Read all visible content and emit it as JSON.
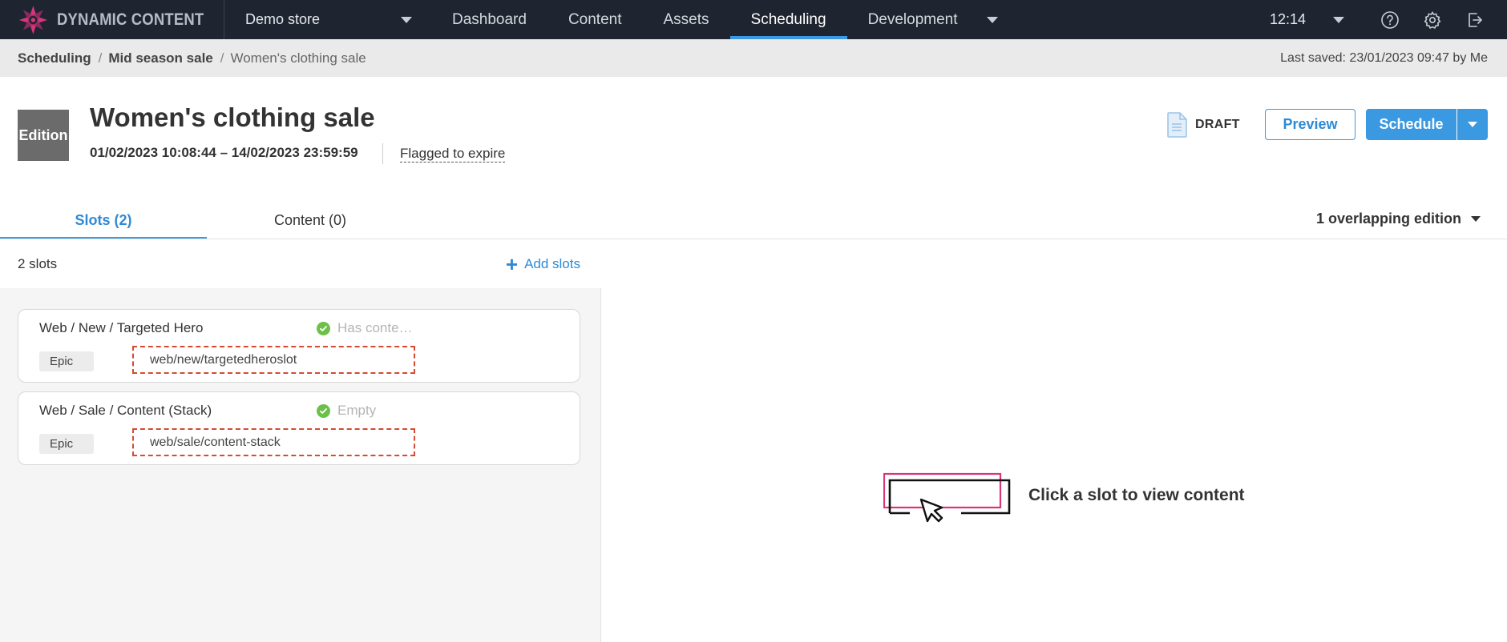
{
  "app": {
    "logo_text": "DYNAMIC CONTENT",
    "store": "Demo store",
    "nav": [
      "Dashboard",
      "Content",
      "Assets",
      "Scheduling",
      "Development"
    ],
    "active_nav": "Scheduling",
    "time": "12:14"
  },
  "breadcrumb": {
    "items": [
      "Scheduling",
      "Mid season sale",
      "Women's clothing sale"
    ],
    "separator": "/",
    "last_saved": "Last saved: 23/01/2023 09:47 by Me"
  },
  "edition": {
    "badge": "Edition",
    "title": "Women's clothing sale",
    "dates": "01/02/2023 10:08:44  –  14/02/2023 23:59:59",
    "flag": "Flagged to expire",
    "status": "DRAFT",
    "preview_label": "Preview",
    "schedule_label": "Schedule"
  },
  "tabs": [
    {
      "label": "Slots (2)",
      "active": true
    },
    {
      "label": "Content (0)",
      "active": false
    }
  ],
  "overlap_label": "1 overlapping edition",
  "slots": {
    "count_label": "2 slots",
    "add_label": "Add slots",
    "items": [
      {
        "name": "Web / New / Targeted Hero",
        "status": "Has conte…",
        "tag": "Epic",
        "path": "web/new/targetedheroslot"
      },
      {
        "name": "Web / Sale / Content (Stack)",
        "status": "Empty",
        "tag": "Epic",
        "path": "web/sale/content-stack"
      }
    ]
  },
  "empty_state": "Click a slot to view content",
  "colors": {
    "topbar": "#1f2530",
    "accent": "#3a99e0",
    "logo_pink": "#d9357a",
    "dashed_red": "#d54a32",
    "check_green": "#6cc04a"
  },
  "icons": [
    "logo-icon",
    "chevron-down-icon",
    "help-icon",
    "gear-icon",
    "logout-icon",
    "document-icon",
    "plus-icon",
    "check-icon",
    "cursor-slot-illustration"
  ]
}
